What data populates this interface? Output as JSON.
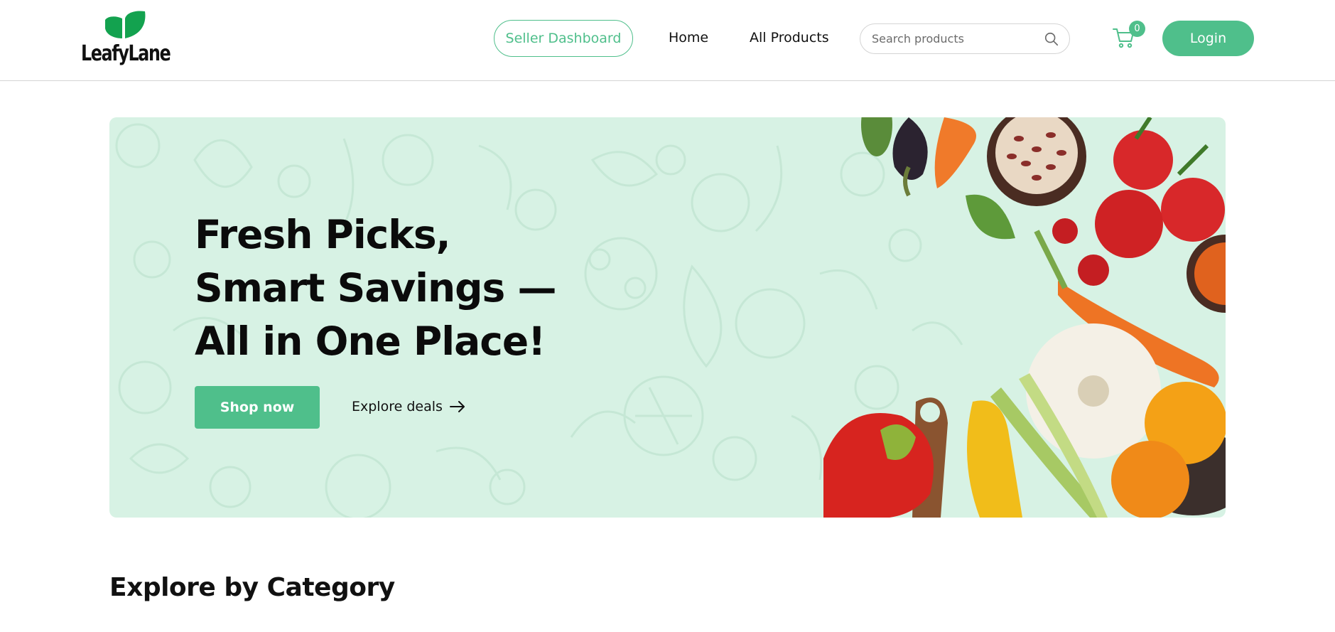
{
  "brand": {
    "name": "LeafyLane",
    "accent": "#4fbf8b",
    "leaf_color": "#13a24f"
  },
  "nav": {
    "seller_dashboard": "Seller Dashboard",
    "home": "Home",
    "all_products": "All Products",
    "search_placeholder": "Search products",
    "search_icon": "search-icon",
    "cart_icon": "shopping-cart-icon",
    "cart_count": "0",
    "login": "Login"
  },
  "hero": {
    "title": "Fresh Picks, Smart Savings — All in One Place!",
    "primary_cta": "Shop now",
    "secondary_cta": "Explore deals",
    "secondary_icon": "arrow-right-icon",
    "background": "#d7f2e4"
  },
  "sections": {
    "explore_title": "Explore by Category"
  }
}
